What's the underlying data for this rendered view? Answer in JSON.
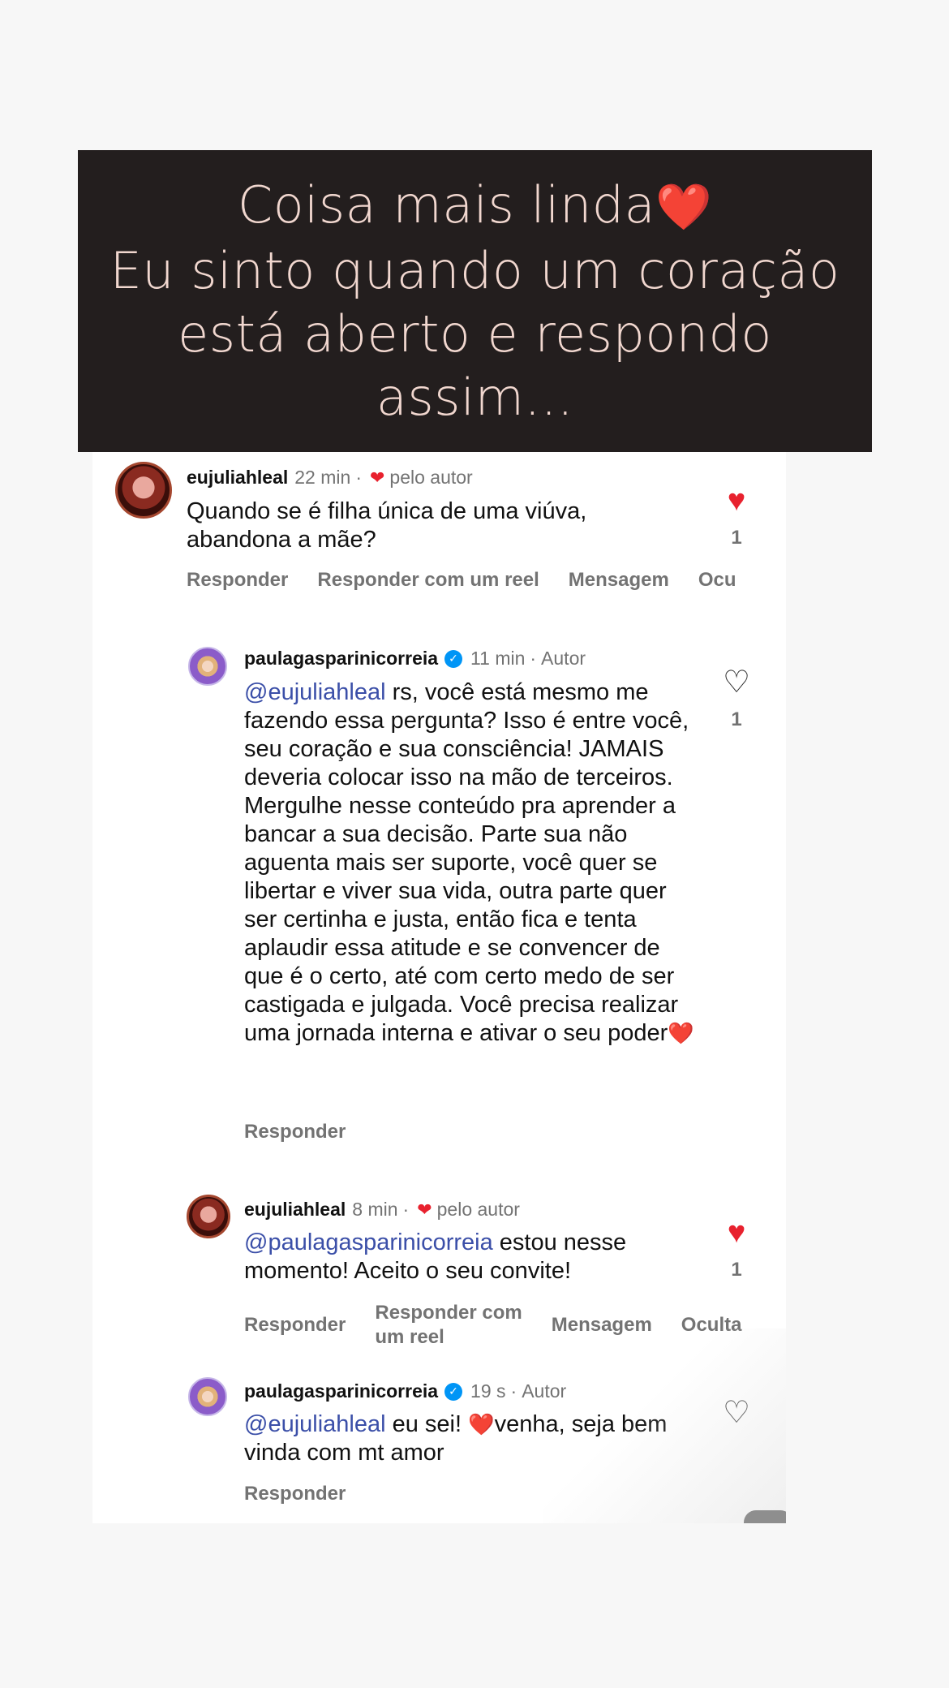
{
  "banner": {
    "lines": [
      "Coisa mais linda",
      "Eu sinto quando um coração",
      "está aberto e respondo",
      "assim..."
    ],
    "heart": "❤️"
  },
  "labels": {
    "reply": "Responder",
    "reply_reel": "Responder com um reel",
    "reply_reel_l1": "Responder com",
    "reply_reel_l2": "um reel",
    "message": "Mensagem",
    "hide_cut1": "Ocu",
    "hide_cut2": "Oculta",
    "by_author": "pelo autor",
    "author": "Autor"
  },
  "comments": [
    {
      "user": "eujuliahleal",
      "time": "22 min",
      "text": "Quando se é filha única de uma viúva, abandona a mãe?",
      "likes": "1",
      "liked": true
    },
    {
      "user": "paulagasparinicorreia",
      "time": "11 min",
      "mention": "@eujuliahleal",
      "text": " rs, você está mesmo me fazendo essa pergunta? Isso é entre você, seu coração e sua consciência! JAMAIS deveria colocar isso na mão de terceiros. Mergulhe nesse conteúdo pra aprender a bancar a sua decisão. Parte sua não aguenta mais ser suporte, você quer se libertar e viver sua vida, outra parte quer ser certinha e justa, então fica e tenta aplaudir essa atitude e se convencer de que é o certo, até com certo medo de ser castigada e julgada. Você precisa realizar uma jornada interna e ativar o seu poder",
      "emoji": "❤️",
      "likes": "1",
      "liked": false
    },
    {
      "user": "eujuliahleal",
      "time": "8 min",
      "mention": "@paulagasparinicorreia",
      "text": " estou nesse momento! Aceito o seu convite!",
      "likes": "1",
      "liked": true
    },
    {
      "user": "paulagasparinicorreia",
      "time": "19 s",
      "mention": "@eujuliahleal",
      "text_before": " eu sei! ",
      "emoji": "❤️",
      "text_after": "venha, seja bem vinda com mt amor",
      "liked": false
    }
  ],
  "colors": {
    "banner_bg": "#231e1e",
    "banner_text": "#f1d7cf",
    "like_red": "#e8212e",
    "mention_blue": "#3b4fa8",
    "verified_blue": "#0095f6"
  }
}
